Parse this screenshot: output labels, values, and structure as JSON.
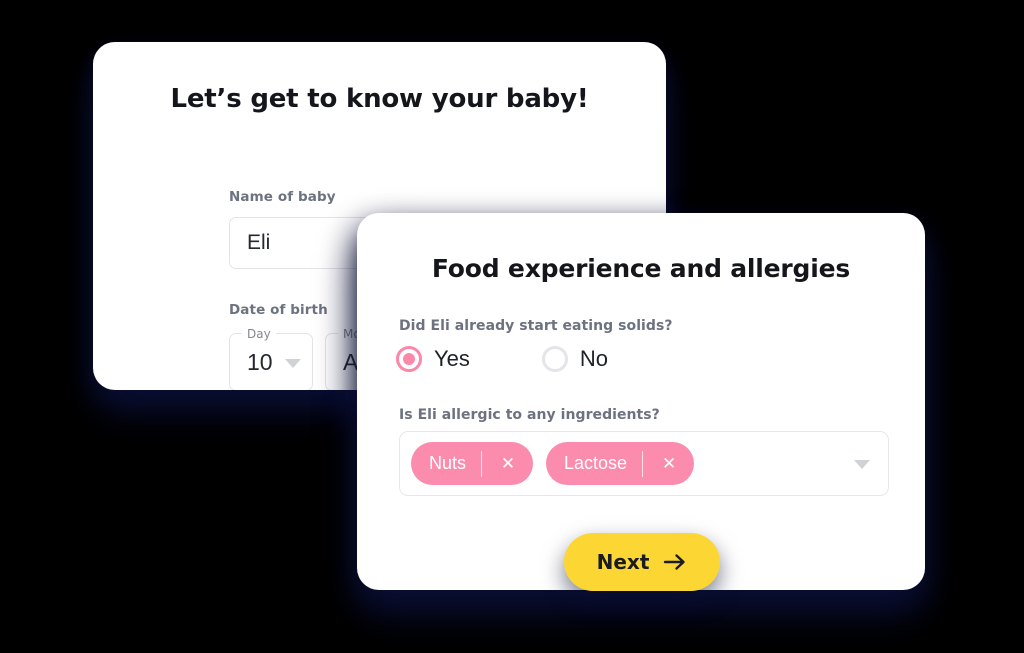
{
  "theme": {
    "background": "#000000",
    "card_bg": "#ffffff",
    "accent_pink": "#fb87a9",
    "chip_pink": "#fb8cae",
    "accent_yellow": "#fcd734",
    "text_dark": "#15161c",
    "text_muted": "#6d7280",
    "border": "#e2e4e8"
  },
  "baby_card": {
    "title": "Let’s get to know your baby!",
    "name_label": "Name of baby",
    "name_value": "Eli",
    "name_placeholder": "Name of baby",
    "dob_label": "Date of birth",
    "day": {
      "label": "Day",
      "value": "10",
      "icon": "chevron-down-icon"
    },
    "month": {
      "label": "Month",
      "value": "August",
      "icon": "chevron-down-icon"
    }
  },
  "food_card": {
    "title": "Food experience and allergies",
    "solids_question": "Did Eli already start eating solids?",
    "solids_options": [
      {
        "label": "Yes",
        "selected": true
      },
      {
        "label": "No",
        "selected": false
      }
    ],
    "allergy_question": "Is Eli allergic to any ingredients?",
    "allergy_chips": [
      {
        "label": "Nuts",
        "remove_icon": "close-icon"
      },
      {
        "label": "Lactose",
        "remove_icon": "close-icon"
      }
    ],
    "allergy_dropdown_icon": "chevron-down-icon",
    "next_button": {
      "label": "Next",
      "icon": "arrow-right-icon"
    }
  }
}
